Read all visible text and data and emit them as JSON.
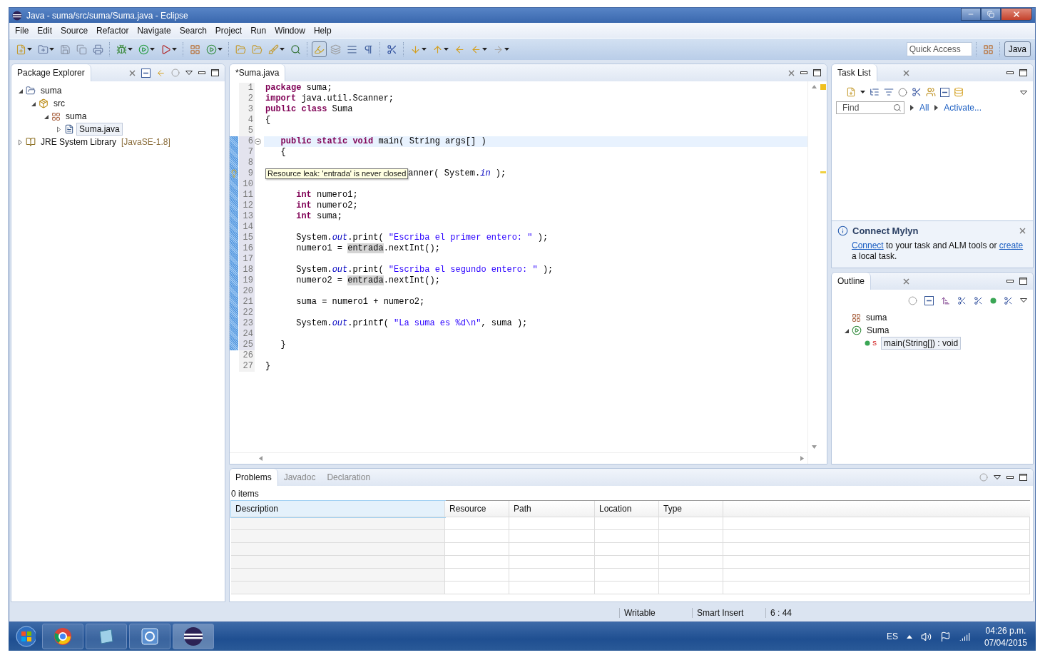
{
  "window": {
    "title": "Java - suma/src/suma/Suma.java - Eclipse"
  },
  "menu": [
    "File",
    "Edit",
    "Source",
    "Refactor",
    "Navigate",
    "Search",
    "Project",
    "Run",
    "Window",
    "Help"
  ],
  "toolbar": {
    "quick_access": {
      "placeholder": "Quick Access"
    },
    "perspective": {
      "label": "Java",
      "selected": true
    }
  },
  "package_explorer": {
    "title": "Package Explorer",
    "tree": [
      {
        "label": "suma",
        "kind": "project",
        "expanded": true,
        "selected": false,
        "children": [
          {
            "label": "src",
            "kind": "source-folder",
            "expanded": true,
            "selected": false,
            "children": [
              {
                "label": "suma",
                "kind": "package",
                "expanded": true,
                "selected": false,
                "children": [
                  {
                    "label": "Suma.java",
                    "kind": "java-file",
                    "expanded": false,
                    "selected": true
                  }
                ]
              }
            ]
          }
        ]
      },
      {
        "label": "JRE System Library",
        "decoration": "[JavaSE-1.8]",
        "kind": "library",
        "expanded": false,
        "selected": false
      }
    ]
  },
  "editor": {
    "tab": {
      "label": "*Suma.java",
      "selected": true
    },
    "lines": [
      {
        "number": "1",
        "changed": false,
        "current": false,
        "tokens": [
          {
            "kind": "keyword",
            "text": "package"
          },
          {
            "kind": "plain",
            "text": " suma;"
          }
        ]
      },
      {
        "number": "2",
        "changed": false,
        "current": false,
        "tokens": [
          {
            "kind": "keyword",
            "text": "import"
          },
          {
            "kind": "plain",
            "text": " java.util.Scanner;"
          }
        ]
      },
      {
        "number": "3",
        "changed": false,
        "current": false,
        "tokens": [
          {
            "kind": "keyword",
            "text": "public class"
          },
          {
            "kind": "plain",
            "text": " Suma"
          }
        ]
      },
      {
        "number": "4",
        "changed": false,
        "current": false,
        "tokens": [
          {
            "kind": "plain",
            "text": "{"
          }
        ]
      },
      {
        "number": "5",
        "changed": false,
        "current": false
      },
      {
        "number": "6",
        "changed": true,
        "current": true,
        "folding": true,
        "tokens": [
          {
            "kind": "keyword",
            "text": "   public static void"
          },
          {
            "kind": "plain",
            "text": " main( String args[] )"
          }
        ]
      },
      {
        "number": "7",
        "changed": true,
        "current": false,
        "tokens": [
          {
            "kind": "plain",
            "text": "   {"
          }
        ]
      },
      {
        "number": "8",
        "changed": true,
        "current": false
      },
      {
        "number": "9",
        "changed": true,
        "current": false,
        "warning": true,
        "tooltip": "Resource leak: 'entrada' is never closed",
        "tokens": [
          {
            "kind": "plain",
            "text": "anner( System."
          },
          {
            "kind": "field",
            "text": "in"
          },
          {
            "kind": "plain",
            "text": " );"
          }
        ]
      },
      {
        "number": "10",
        "changed": true,
        "current": false
      },
      {
        "number": "11",
        "changed": true,
        "current": false,
        "tokens": [
          {
            "kind": "keyword",
            "text": "      int"
          },
          {
            "kind": "plain",
            "text": " numero1;"
          }
        ]
      },
      {
        "number": "12",
        "changed": true,
        "current": false,
        "tokens": [
          {
            "kind": "keyword",
            "text": "      int"
          },
          {
            "kind": "plain",
            "text": " numero2;"
          }
        ]
      },
      {
        "number": "13",
        "changed": true,
        "current": false,
        "tokens": [
          {
            "kind": "keyword",
            "text": "      int"
          },
          {
            "kind": "plain",
            "text": " suma;"
          }
        ]
      },
      {
        "number": "14",
        "changed": true,
        "current": false
      },
      {
        "number": "15",
        "changed": true,
        "current": false,
        "tokens": [
          {
            "kind": "plain",
            "text": "      System."
          },
          {
            "kind": "field",
            "text": "out"
          },
          {
            "kind": "plain",
            "text": ".print( "
          },
          {
            "kind": "string",
            "text": "\"Escriba el primer entero: \""
          },
          {
            "kind": "plain",
            "text": " );"
          }
        ]
      },
      {
        "number": "16",
        "changed": true,
        "current": false,
        "tokens": [
          {
            "kind": "plain",
            "text": "      numero1 = "
          },
          {
            "kind": "occurrence",
            "text": "entrada"
          },
          {
            "kind": "plain",
            "text": ".nextInt();"
          }
        ]
      },
      {
        "number": "17",
        "changed": true,
        "current": false
      },
      {
        "number": "18",
        "changed": true,
        "current": false,
        "tokens": [
          {
            "kind": "plain",
            "text": "      System."
          },
          {
            "kind": "field",
            "text": "out"
          },
          {
            "kind": "plain",
            "text": ".print( "
          },
          {
            "kind": "string",
            "text": "\"Escriba el segundo entero: \""
          },
          {
            "kind": "plain",
            "text": " );"
          }
        ]
      },
      {
        "number": "19",
        "changed": true,
        "current": false,
        "tokens": [
          {
            "kind": "plain",
            "text": "      numero2 = "
          },
          {
            "kind": "occurrence",
            "text": "entrada"
          },
          {
            "kind": "plain",
            "text": ".nextInt();"
          }
        ]
      },
      {
        "number": "20",
        "changed": true,
        "current": false
      },
      {
        "number": "21",
        "changed": true,
        "current": false,
        "tokens": [
          {
            "kind": "plain",
            "text": "      suma = numero1 + numero2;"
          }
        ]
      },
      {
        "number": "22",
        "changed": true,
        "current": false
      },
      {
        "number": "23",
        "changed": true,
        "current": false,
        "tokens": [
          {
            "kind": "plain",
            "text": "      System."
          },
          {
            "kind": "field",
            "text": "out"
          },
          {
            "kind": "plain",
            "text": ".printf( "
          },
          {
            "kind": "string",
            "text": "\"La suma es %d\\n\""
          },
          {
            "kind": "plain",
            "text": ", suma );"
          }
        ]
      },
      {
        "number": "24",
        "changed": true,
        "current": false
      },
      {
        "number": "25",
        "changed": true,
        "current": false,
        "tokens": [
          {
            "kind": "plain",
            "text": "   }"
          }
        ]
      },
      {
        "number": "26",
        "changed": false,
        "current": false
      },
      {
        "number": "27",
        "changed": false,
        "current": false,
        "tokens": [
          {
            "kind": "plain",
            "text": "}"
          }
        ]
      }
    ]
  },
  "task_list": {
    "title": "Task List",
    "find": {
      "placeholder": "Find"
    },
    "links": [
      "All",
      "Activate..."
    ]
  },
  "mylyn": {
    "title": "Connect Mylyn",
    "text": [
      {
        "text": "Connect",
        "link": true
      },
      {
        "text": " to your task and ALM tools or ",
        "link": false
      },
      {
        "text": "create",
        "link": true
      },
      {
        "text": " a local task.",
        "link": false
      }
    ]
  },
  "outline": {
    "title": "Outline",
    "tree": [
      {
        "label": "suma",
        "kind": "package",
        "selected": false
      },
      {
        "label": "Suma",
        "kind": "class",
        "expanded": true,
        "selected": false,
        "children": [
          {
            "label": "main(String[]) : void",
            "kind": "method",
            "static_mark": "S",
            "selected": true
          }
        ]
      }
    ]
  },
  "problems": {
    "tabs": [
      {
        "label": "Problems",
        "selected": true
      },
      {
        "label": "Javadoc",
        "selected": false
      },
      {
        "label": "Declaration",
        "selected": false
      }
    ],
    "count": "0 items",
    "columns": [
      {
        "label": "Description",
        "sorted": true
      },
      {
        "label": "Resource",
        "sorted": false
      },
      {
        "label": "Path",
        "sorted": false
      },
      {
        "label": "Location",
        "sorted": false
      },
      {
        "label": "Type",
        "sorted": false
      }
    ]
  },
  "status_bar": [
    "Writable",
    "Smart Insert",
    "6 : 44"
  ],
  "taskbar": {
    "language": "ES",
    "time": "04:26 p.m.",
    "date": "07/04/2015"
  }
}
